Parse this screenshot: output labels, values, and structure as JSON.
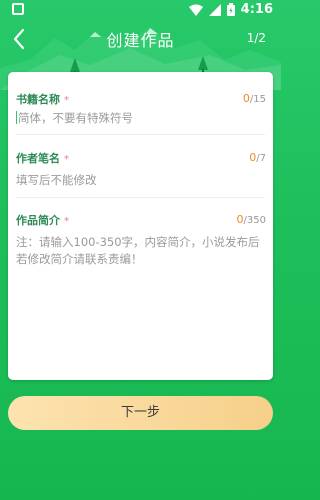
{
  "status_bar": {
    "time": "4:16"
  },
  "app_bar": {
    "title": "创建作品",
    "pager": "1/2"
  },
  "form": {
    "book_name": {
      "label": "书籍名称",
      "required_mark": "*",
      "placeholder": "简体，不要有特殊符号",
      "count_current": "0",
      "count_max": "/15"
    },
    "author_name": {
      "label": "作者笔名",
      "required_mark": "*",
      "placeholder": "填写后不能修改",
      "count_current": "0",
      "count_max": "/7"
    },
    "intro": {
      "label": "作品简介",
      "required_mark": "*",
      "placeholder": "注：请输入100-350字，内容简介，小说发布后若修改简介请联系责编！",
      "count_current": "0",
      "count_max": "/350"
    }
  },
  "next_button": {
    "label": "下一步"
  },
  "colors": {
    "primary_green": "#1fbf5c",
    "label_green": "#2e8b57",
    "required_red": "#f27a7a",
    "counter_orange": "#f08a24",
    "button_gold": "#f6d08a"
  },
  "icons": [
    "square-icon",
    "wifi-icon",
    "signal-icon",
    "battery-icon",
    "back-arrow-icon"
  ]
}
